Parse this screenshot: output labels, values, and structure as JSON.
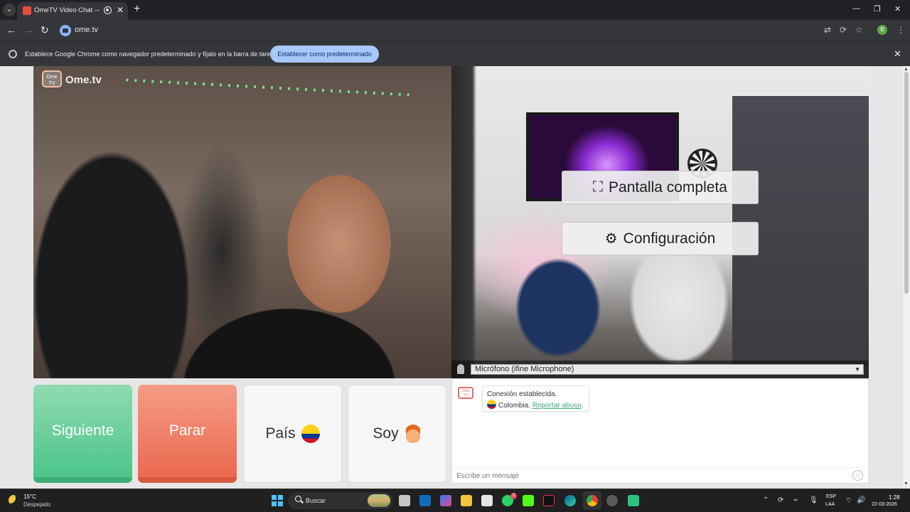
{
  "browser": {
    "tab_title": "OmeTV Video Chat — Ome",
    "url": "ome.tv",
    "profile_initial": "B",
    "infobar_text": "Establece Google Chrome como navegador predeterminado y fíjalo en la barra de tareas",
    "infobar_button": "Establecer como predeterminado"
  },
  "video": {
    "logo_text": "Ome.tv",
    "logo_small": "Ome TV",
    "fullscreen_label": "Pantalla completa",
    "settings_label": "Configuración",
    "mic_select_value": "Micrófono (ifine Microphone)"
  },
  "controls": {
    "next_label": "Siguiente",
    "stop_label": "Parar",
    "country_label": "País",
    "gender_label": "Soy"
  },
  "chat": {
    "logo_small": "Ome TV",
    "status": "Conexión establecida.",
    "country": "Colombia.",
    "report_link": "Reportar abuso",
    "report_suffix": ".",
    "input_placeholder": "Escribe un mensaje"
  },
  "taskbar": {
    "temperature": "15°C",
    "condition": "Despejado",
    "search_label": "Buscar",
    "badge_count": "2",
    "lang_line1": "ESP",
    "lang_line2": "LAA",
    "time": "1:28",
    "date": "22-03-2026"
  },
  "colors": {
    "next": "#4dc58a",
    "stop": "#ea6a4f",
    "chrome_button": "#a8c7fa",
    "link": "#3aa876"
  },
  "icons": [
    "chevron-down-icon",
    "record-icon",
    "close-icon",
    "plus-icon",
    "back-icon",
    "forward-icon",
    "reload-icon",
    "translate-icon",
    "cast-icon",
    "star-icon",
    "menu-icon",
    "chrome-icon",
    "fullscreen-icon",
    "gear-icon",
    "microphone-icon",
    "colombia-flag-icon",
    "boy-emoji-icon",
    "smiley-icon",
    "windows-start-icon",
    "search-icon",
    "weather-moon-icon",
    "wifi-icon",
    "volume-icon"
  ]
}
